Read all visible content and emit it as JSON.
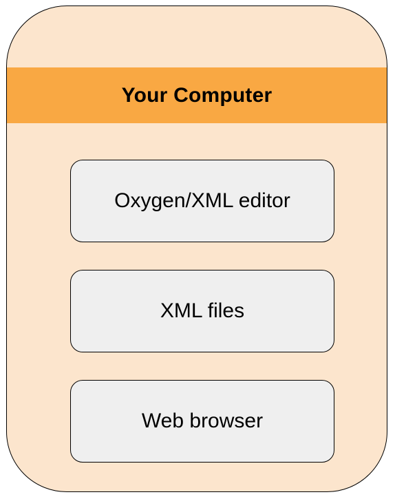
{
  "container": {
    "title": "Your Computer",
    "colors": {
      "background": "#fce5cd",
      "banner": "#f9a843",
      "box": "#efefef",
      "border": "#000000"
    }
  },
  "components": [
    {
      "label": "Oxygen/XML editor"
    },
    {
      "label": "XML files"
    },
    {
      "label": "Web browser"
    }
  ]
}
